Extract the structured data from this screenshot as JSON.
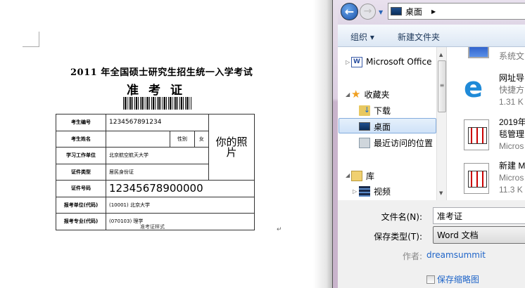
{
  "document": {
    "exam_title": "2011 年全国硕士研究生招生统一入学考试",
    "card_title": "准考证",
    "rows": [
      {
        "label": "考生编号",
        "value": "1234567891234"
      },
      {
        "label": "考生姓名",
        "value": "",
        "gender_label": "性别",
        "gender_value": "女"
      },
      {
        "label": "学习工作单位",
        "value": "北京航空航天大学"
      },
      {
        "label": "证件类型",
        "value": "居民身份证"
      },
      {
        "label": "证件号码",
        "value": "12345678900000"
      },
      {
        "label": "报考单位(代码)",
        "value": "(10001) 北京大学"
      },
      {
        "label": "报考专业(代码)",
        "value": "(070103) 理学"
      }
    ],
    "photo": "你的照片",
    "caption": "准考证样式",
    "paragraph_mark": "↵"
  },
  "dialog": {
    "address": "桌面",
    "toolbar": {
      "organize": "组织 ▾",
      "new_folder": "新建文件夹"
    },
    "nav": {
      "office": "Microsoft Office",
      "favorites": "收藏夹",
      "downloads": "下载",
      "desktop": "桌面",
      "recent": "最近访问的位置",
      "library": "库",
      "video": "视频"
    },
    "files": [
      {
        "name": "",
        "detail": "系统文"
      },
      {
        "name": "网址导",
        "detail": "快捷方",
        "size": "1.31 K"
      },
      {
        "name": "2019年",
        "name2": "毯管理",
        "detail": "Micros"
      },
      {
        "name": "新建 M",
        "detail": "Micros",
        "size": "11.3 K"
      }
    ],
    "filename_label": "文件名(N):",
    "filename_value": "准考证",
    "filetype_label": "保存类型(T):",
    "filetype_value": "Word 文档",
    "author_label": "作者:",
    "author_value": "dreamsummit",
    "thumbnail_label": "保存缩略图"
  }
}
